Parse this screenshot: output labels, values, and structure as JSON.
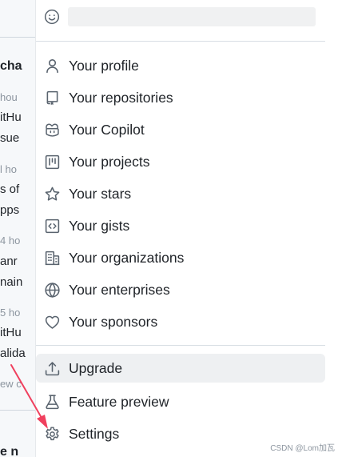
{
  "background": {
    "fragments": [
      "cha",
      "hou",
      "itHu",
      "sue",
      "l ho",
      "s of",
      "pps",
      "4 ho",
      "anr",
      "nain",
      "5 ho",
      "itHu",
      "alida",
      "ew c",
      "e n"
    ]
  },
  "status": {
    "placeholder": ""
  },
  "menu": {
    "items": [
      {
        "label": "Your profile",
        "icon": "person-icon"
      },
      {
        "label": "Your repositories",
        "icon": "repo-icon"
      },
      {
        "label": "Your Copilot",
        "icon": "copilot-icon"
      },
      {
        "label": "Your projects",
        "icon": "project-icon"
      },
      {
        "label": "Your stars",
        "icon": "star-icon"
      },
      {
        "label": "Your gists",
        "icon": "code-square-icon"
      },
      {
        "label": "Your organizations",
        "icon": "organization-icon"
      },
      {
        "label": "Your enterprises",
        "icon": "globe-icon"
      },
      {
        "label": "Your sponsors",
        "icon": "heart-icon"
      }
    ],
    "secondary": [
      {
        "label": "Upgrade",
        "icon": "upload-icon"
      },
      {
        "label": "Feature preview",
        "icon": "beaker-icon"
      },
      {
        "label": "Settings",
        "icon": "gear-icon"
      }
    ]
  },
  "colors": {
    "icon": "#59636e",
    "highlight": "#eef0f2",
    "arrow": "#f0405e"
  },
  "watermark": "CSDN @Lom加瓦"
}
